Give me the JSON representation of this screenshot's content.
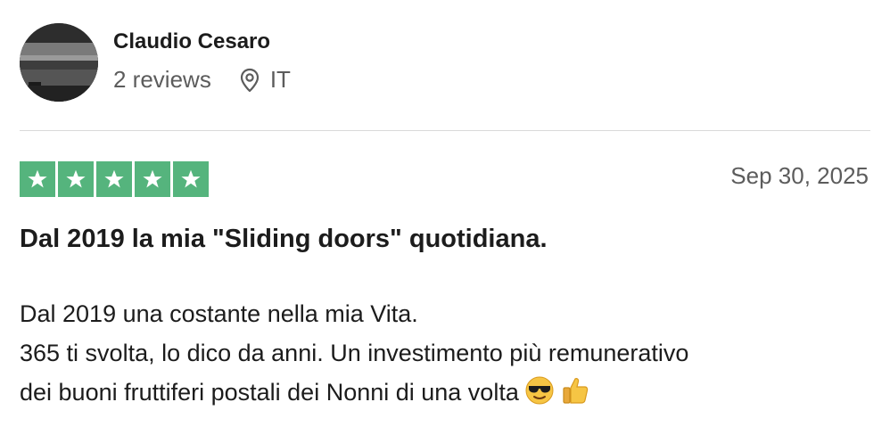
{
  "reviewer": {
    "name": "Claudio Cesaro",
    "reviews": "2 reviews",
    "location_icon": "location-pin-icon",
    "country": "IT"
  },
  "review": {
    "rating": 5,
    "max_rating": 5,
    "star_color": "#55b47d",
    "date": "Sep 30, 2025",
    "title": "Dal 2019 la mia \"Sliding doors\" quotidiana.",
    "body_lines": [
      "Dal 2019 una costante nella mia Vita.",
      "365 ti svolta, lo dico da anni. Un investimento più remunerativo",
      "dei buoni fruttiferi postali dei Nonni di una volta"
    ],
    "emojis": [
      "sunglasses-face-emoji",
      "thumbs-up-emoji"
    ]
  }
}
